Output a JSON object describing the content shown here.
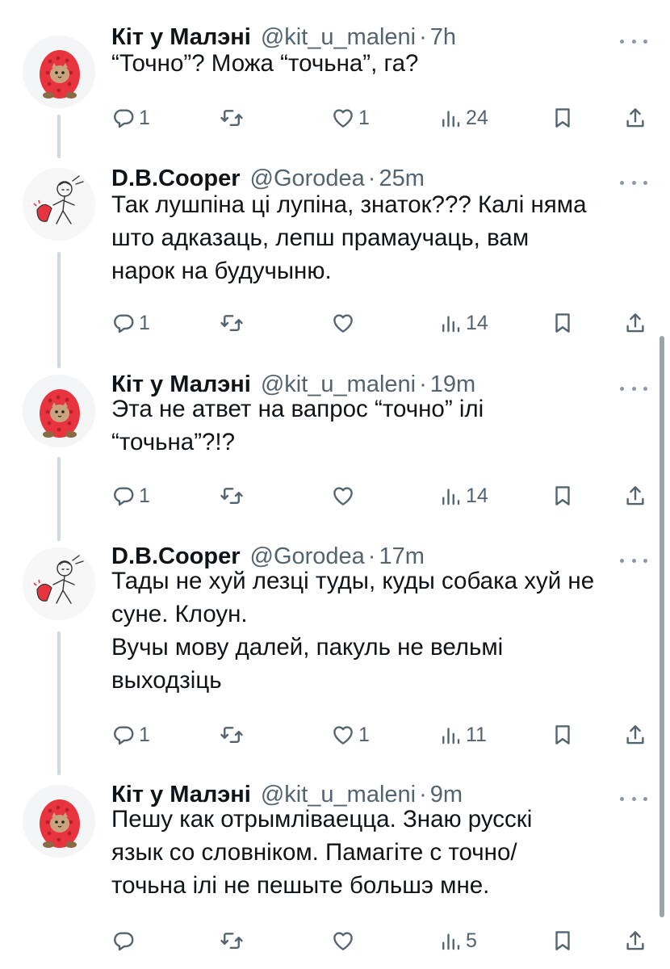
{
  "tweets": [
    {
      "name": "Кіт у Малэні",
      "handle": "@kit_u_maleni",
      "time": "7h",
      "lines": [
        "“Точно”? Можа “точьна”, га?"
      ],
      "avatar_icon": "raspberry-cat-avatar",
      "replies": "1",
      "retweets": "",
      "likes": "1",
      "views": "24"
    },
    {
      "name": "D.B.Cooper",
      "handle": "@Gorodea",
      "time": "25m",
      "lines": [
        "Так лушпіна ці лупіна, знаток??? Калі няма",
        "што адказаць, лепш прамаучаць, вам",
        "нарок на будучыню."
      ],
      "avatar_icon": "sketch-character-avatar",
      "replies": "1",
      "retweets": "",
      "likes": "",
      "views": "14"
    },
    {
      "name": "Кіт у Малэні",
      "handle": "@kit_u_maleni",
      "time": "19m",
      "lines": [
        "Эта не атвет на вапрос “точно” ілі",
        "“точьна”?!?"
      ],
      "avatar_icon": "raspberry-cat-avatar",
      "replies": "1",
      "retweets": "",
      "likes": "",
      "views": "14"
    },
    {
      "name": "D.B.Cooper",
      "handle": "@Gorodea",
      "time": "17m",
      "lines": [
        "Тады не хуй лезці туды, куды собака хуй не",
        "суне. Клоун.",
        "Вучы мову далей, пакуль не вельмі",
        "выходзіць"
      ],
      "avatar_icon": "sketch-character-avatar",
      "replies": "1",
      "retweets": "",
      "likes": "1",
      "views": "11"
    },
    {
      "name": "Кіт у Малэні",
      "handle": "@kit_u_maleni",
      "time": "9m",
      "lines": [
        "Пешу как отрымліваецца. Знаю русскі",
        "язык со словніком. Памагіте с точно/",
        "точьна ілі не пешыте большэ мне."
      ],
      "avatar_icon": "raspberry-cat-avatar",
      "replies": "",
      "retweets": "",
      "likes": "",
      "views": "5"
    }
  ],
  "separator": "·",
  "colors": {
    "text": "#0f1419",
    "muted": "#536471",
    "thread_line": "#cfd9de",
    "raspberry": "#e8343f"
  }
}
